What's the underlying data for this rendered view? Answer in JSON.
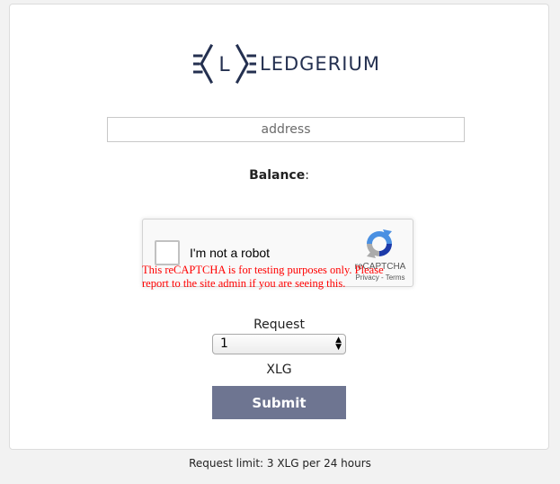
{
  "logo": {
    "text": "LEDGERIUM",
    "icon": "ledgerium-logo-icon"
  },
  "address_input": {
    "placeholder": "address",
    "value": ""
  },
  "balance": {
    "label": "Balance",
    "suffix": ":",
    "value": ""
  },
  "captcha": {
    "label": "I'm not a robot",
    "brand": "reCAPTCHA",
    "links": "Privacy - Terms",
    "warning": "This reCAPTCHA is for testing purposes only. Please report to the site admin if you are seeing this."
  },
  "request": {
    "label": "Request",
    "selected": "1",
    "unit": "XLG"
  },
  "submit_label": "Submit",
  "footer": {
    "note": "Request limit: 3 XLG per 24 hours"
  },
  "colors": {
    "brand": "#243050",
    "button": "#6e7591",
    "warning": "#ff0000",
    "background": "#f2f2f2"
  }
}
